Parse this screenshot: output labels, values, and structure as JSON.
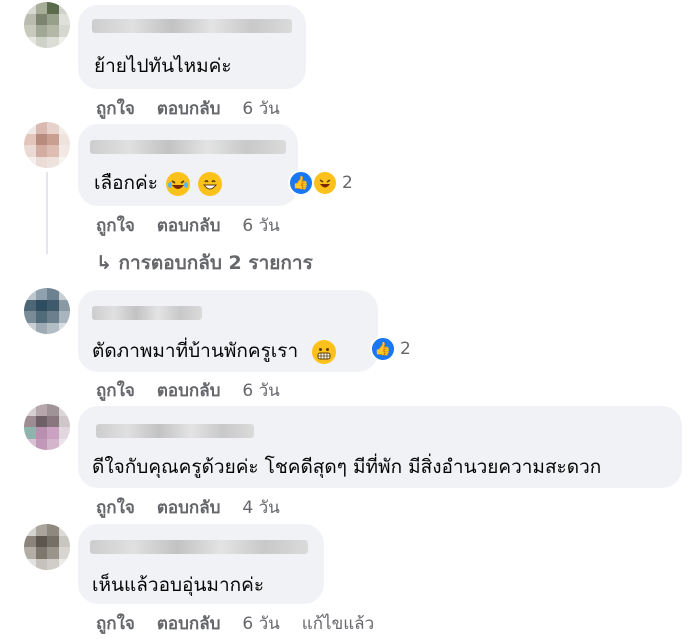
{
  "comments": [
    {
      "text": "ย้ายไปทันไหมค่ะ",
      "like": "ถูกใจ",
      "reply": "ตอบกลับ",
      "time": "6 วัน"
    },
    {
      "text": "เลือกค่ะ",
      "like": "ถูกใจ",
      "reply": "ตอบกลับ",
      "time": "6 วัน",
      "reaction_count": "2",
      "emojis": [
        "laughing-tears-emoji",
        "grinning-emoji"
      ],
      "reactions": [
        "like",
        "haha"
      ]
    },
    {
      "text": "ตัดภาพมาที่บ้านพักครูเรา",
      "like": "ถูกใจ",
      "reply": "ตอบกลับ",
      "time": "6 วัน",
      "reaction_count": "2",
      "emojis": [
        "grimacing-emoji"
      ],
      "reactions": [
        "like"
      ]
    },
    {
      "text": "ดีใจกับคุณครูด้วยค่ะ โชคดีสุดๆ มีที่พัก มีสิ่งอำนวยความสะดวก",
      "like": "ถูกใจ",
      "reply": "ตอบกลับ",
      "time": "4 วัน"
    },
    {
      "text": "เห็นแล้วอบอุ่นมากค่ะ",
      "like": "ถูกใจ",
      "reply": "ตอบกลับ",
      "time": "6 วัน",
      "edited": "แก้ไขแล้ว"
    }
  ],
  "replies_link": {
    "arrow": "↳",
    "label": "การตอบกลับ 2 รายการ"
  },
  "colors": {
    "bubble": "#f0f2f5",
    "meta": "#65676b",
    "like_blue": "#1877f2",
    "emoji_yellow": "#fcc21b"
  }
}
